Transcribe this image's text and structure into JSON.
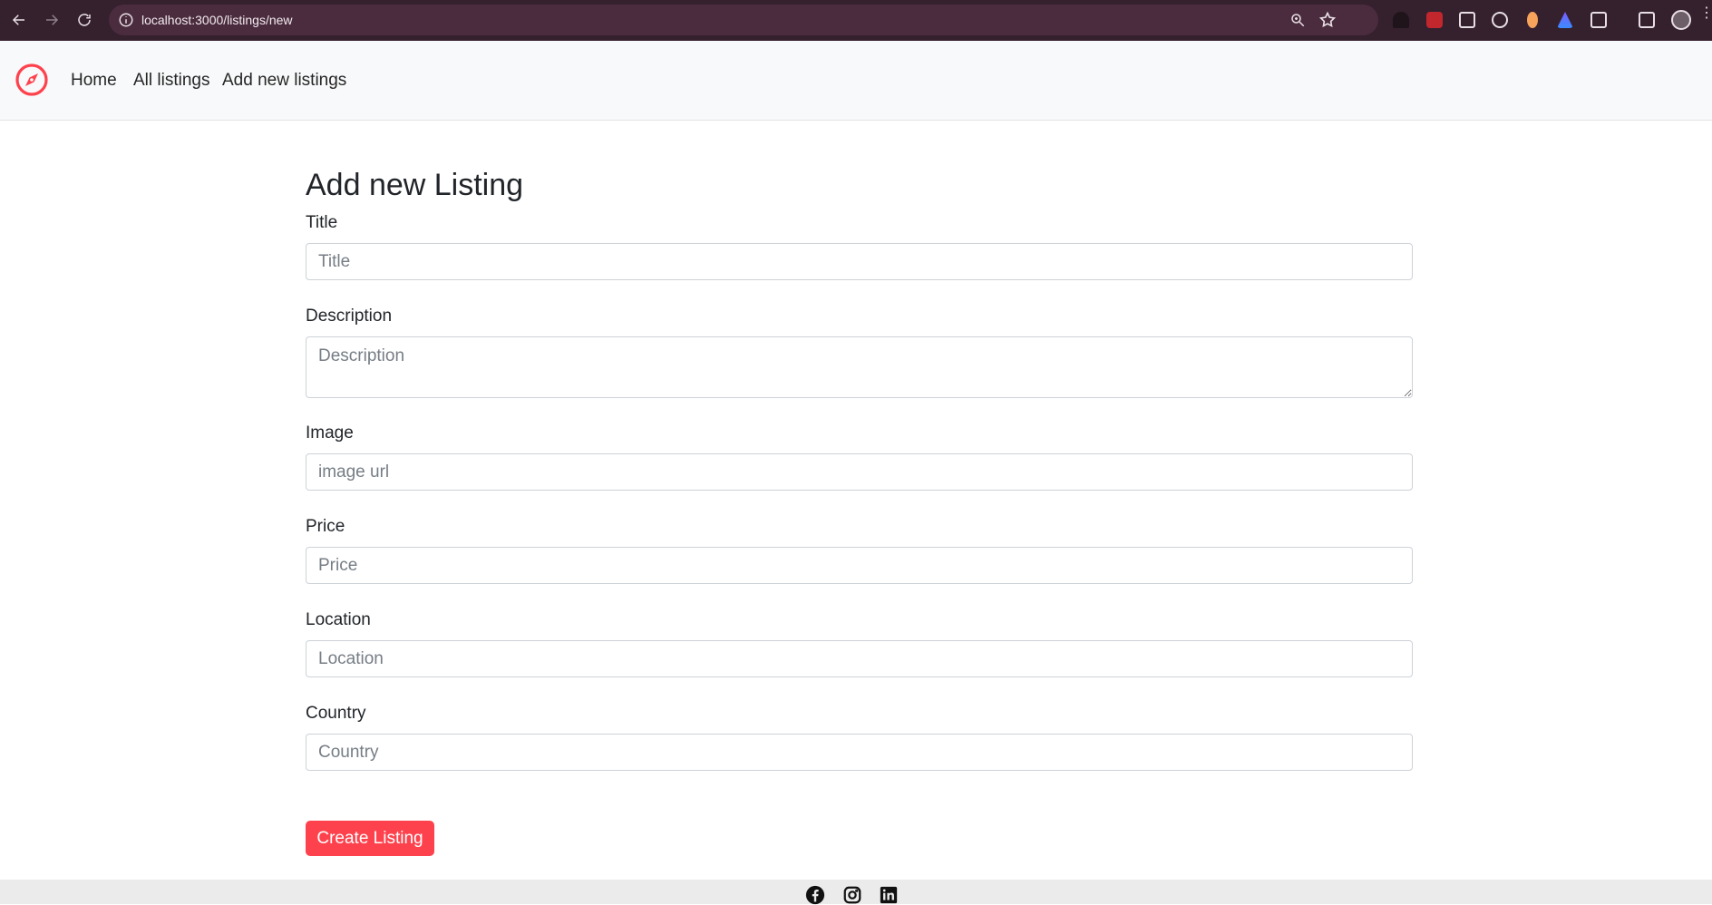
{
  "browser": {
    "url": "localhost:3000/listings/new"
  },
  "navbar": {
    "brand_icon": "compass-icon",
    "links": [
      {
        "label": "Home"
      },
      {
        "label": "All listings"
      },
      {
        "label": "Add new listings"
      }
    ]
  },
  "form": {
    "title": "Add new Listing",
    "fields": {
      "title": {
        "label": "Title",
        "placeholder": "Title",
        "value": ""
      },
      "description": {
        "label": "Description",
        "placeholder": "Description",
        "value": ""
      },
      "image": {
        "label": "Image",
        "placeholder": "image url",
        "value": ""
      },
      "price": {
        "label": "Price",
        "placeholder": "Price",
        "value": ""
      },
      "location": {
        "label": "Location",
        "placeholder": "Location",
        "value": ""
      },
      "country": {
        "label": "Country",
        "placeholder": "Country",
        "value": ""
      }
    },
    "submit_label": "Create Listing"
  },
  "footer": {
    "icons": [
      "facebook-icon",
      "instagram-icon",
      "linkedin-icon"
    ]
  },
  "colors": {
    "brand": "#fe424d",
    "browser_frame": "#35202e"
  }
}
